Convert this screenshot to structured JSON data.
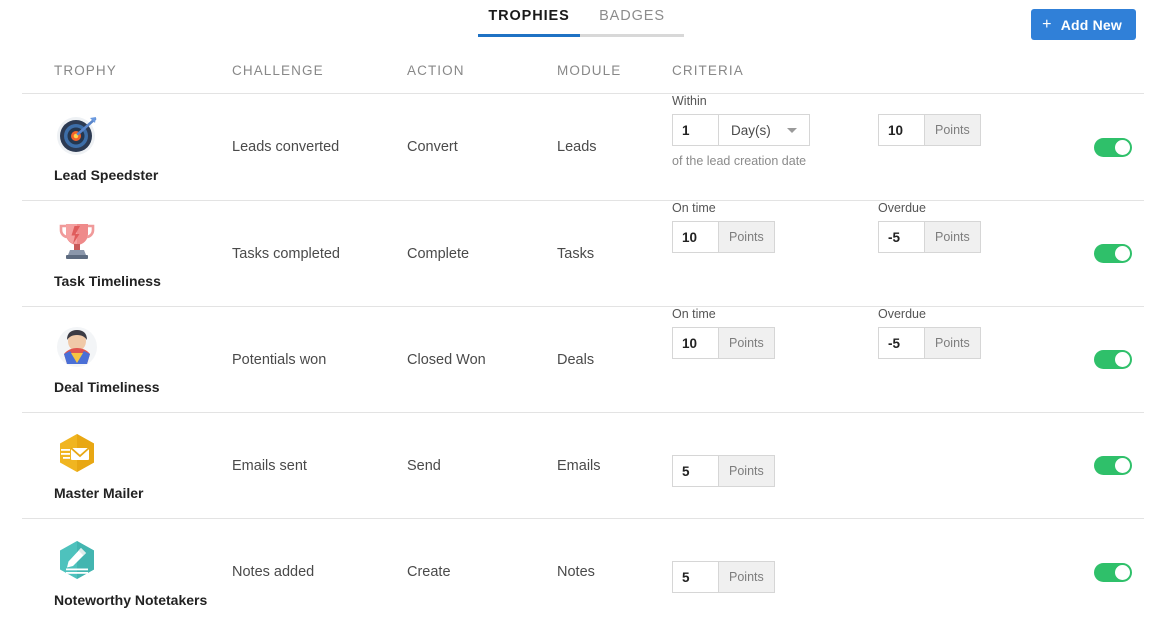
{
  "header": {
    "tabs": [
      {
        "label": "TROPHIES",
        "active": true
      },
      {
        "label": "BADGES",
        "active": false
      }
    ],
    "add_new": {
      "label": "Add New",
      "icon": "plus-icon",
      "color": "#3080d8"
    }
  },
  "table": {
    "columns": [
      "TROPHY",
      "CHALLENGE",
      "ACTION",
      "MODULE",
      "CRITERIA"
    ],
    "rows": [
      {
        "trophy": "Lead Speedster",
        "icon": "target-dartboard-icon",
        "challenge": "Leads converted",
        "action": "Convert",
        "module": "Leads",
        "criteria": {
          "group1": {
            "label": "Within",
            "value": "1",
            "unit": "Day(s)",
            "type": "select"
          },
          "group2": {
            "label": "",
            "value": "10",
            "unit": "Points",
            "type": "points"
          },
          "help": "of the lead creation date"
        },
        "enabled": true
      },
      {
        "trophy": "Task Timeliness",
        "icon": "trophy-cup-icon",
        "challenge": "Tasks completed",
        "action": "Complete",
        "module": "Tasks",
        "criteria": {
          "group1": {
            "label": "On time",
            "value": "10",
            "unit": "Points",
            "type": "points"
          },
          "group2": {
            "label": "Overdue",
            "value": "-5",
            "unit": "Points",
            "type": "points"
          },
          "help": ""
        },
        "enabled": true
      },
      {
        "trophy": "Deal Timeliness",
        "icon": "superhero-avatar-icon",
        "challenge": "Potentials won",
        "action": "Closed Won",
        "module": "Deals",
        "criteria": {
          "group1": {
            "label": "On time",
            "value": "10",
            "unit": "Points",
            "type": "points"
          },
          "group2": {
            "label": "Overdue",
            "value": "-5",
            "unit": "Points",
            "type": "points"
          },
          "help": ""
        },
        "enabled": true
      },
      {
        "trophy": "Master Mailer",
        "icon": "envelope-hexagon-icon",
        "challenge": "Emails sent",
        "action": "Send",
        "module": "Emails",
        "criteria": {
          "group1": {
            "label": "",
            "value": "5",
            "unit": "Points",
            "type": "points"
          },
          "group2": null,
          "help": ""
        },
        "enabled": true
      },
      {
        "trophy": "Noteworthy Notetakers",
        "icon": "pen-note-hexagon-icon",
        "challenge": "Notes added",
        "action": "Create",
        "module": "Notes",
        "criteria": {
          "group1": {
            "label": "",
            "value": "5",
            "unit": "Points",
            "type": "points"
          },
          "group2": null,
          "help": ""
        },
        "enabled": true
      }
    ]
  },
  "colors": {
    "accent_blue": "#3080d8",
    "toggle_green": "#2fc06a",
    "header_text": "#888888",
    "divider": "#e3e3e3"
  }
}
